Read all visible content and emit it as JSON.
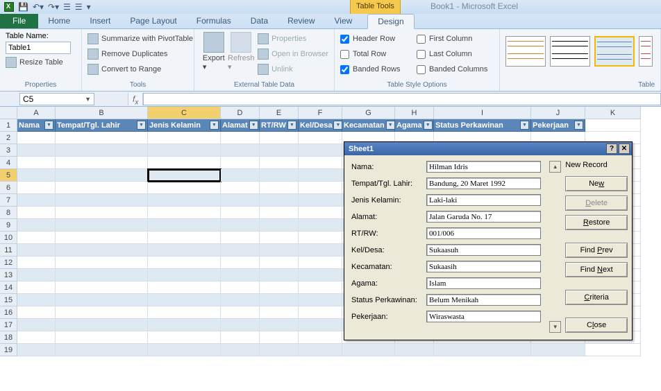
{
  "title": {
    "context": "Table Tools",
    "document": "Book1  -  Microsoft Excel"
  },
  "tabs": {
    "file": "File",
    "home": "Home",
    "insert": "Insert",
    "page": "Page Layout",
    "formulas": "Formulas",
    "data": "Data",
    "review": "Review",
    "view": "View",
    "design": "Design"
  },
  "ribbon": {
    "properties": {
      "tn_label": "Table Name:",
      "tn_value": "Table1",
      "resize": "Resize Table",
      "group": "Properties"
    },
    "tools": {
      "pivot": "Summarize with PivotTable",
      "dup": "Remove Duplicates",
      "convert": "Convert to Range",
      "group": "Tools"
    },
    "ext": {
      "export": "Export",
      "refresh": "Refresh",
      "props": "Properties",
      "open": "Open in Browser",
      "unlink": "Unlink",
      "group": "External Table Data"
    },
    "opts": {
      "header": "Header Row",
      "total": "Total Row",
      "banded_r": "Banded Rows",
      "first": "First Column",
      "last": "Last Column",
      "banded_c": "Banded Columns",
      "group": "Table Style Options"
    },
    "styles": {
      "group": "Table"
    }
  },
  "namebox": "C5",
  "cols": [
    "A",
    "B",
    "C",
    "D",
    "E",
    "F",
    "G",
    "H",
    "I",
    "J",
    "K"
  ],
  "headers": [
    "Nama",
    "Tempat/Tgl. Lahir",
    "Jenis Kelamin",
    "Alamat",
    "RT/RW",
    "Kel/Desa",
    "Kecamatan",
    "Agama",
    "Status Perkawinan",
    "Pekerjaan"
  ],
  "dialog": {
    "title": "Sheet1",
    "record": "New Record",
    "fields": [
      {
        "label": "Nama:",
        "value": "Hilman Idris"
      },
      {
        "label": "Tempat/Tgl. Lahir:",
        "value": "Bandung, 20 Maret 1992"
      },
      {
        "label": "Jenis Kelamin:",
        "value": "Laki-laki"
      },
      {
        "label": "Alamat:",
        "value": "Jalan Garuda No. 17"
      },
      {
        "label": "RT/RW:",
        "value": "001/006"
      },
      {
        "label": "Kel/Desa:",
        "value": "Sukaasuh"
      },
      {
        "label": "Kecamatan:",
        "value": "Sukaasih"
      },
      {
        "label": "Agama:",
        "value": "Islam"
      },
      {
        "label": "Status Perkawinan:",
        "value": "Belum Menikah"
      },
      {
        "label": "Pekerjaan:",
        "value": "Wiraswasta"
      }
    ],
    "buttons": {
      "new": "New",
      "delete": "Delete",
      "restore": "Restore",
      "prev": "Find Prev",
      "next": "Find Next",
      "criteria": "Criteria",
      "close": "Close"
    }
  }
}
